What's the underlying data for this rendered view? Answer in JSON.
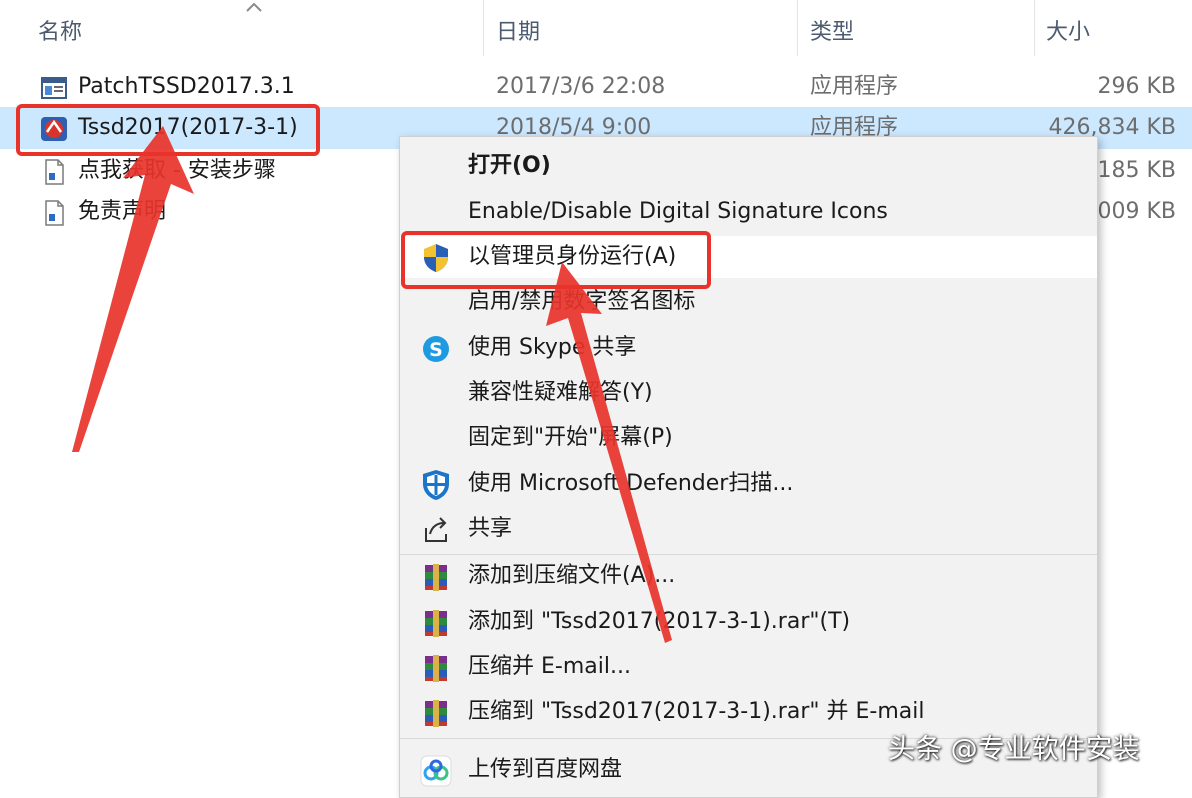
{
  "columns": {
    "name": "名称",
    "date": "日期",
    "type": "类型",
    "size": "大小"
  },
  "files": [
    {
      "name": "PatchTSSD2017.3.1",
      "date": "2017/3/6 22:08",
      "type": "应用程序",
      "size": "296 KB",
      "icon": "exe-window-icon"
    },
    {
      "name": "Tssd2017(2017-3-1)",
      "date": "2018/5/4 9:00",
      "type": "应用程序",
      "size": "426,834 KB",
      "icon": "tssd-app-icon"
    },
    {
      "name": "点我获取 - 安装步骤",
      "date": "",
      "type": "",
      "size": "185 KB",
      "icon": "document-icon"
    },
    {
      "name": "免责声明",
      "date": "",
      "type": "",
      "size": "009 KB",
      "icon": "document-icon"
    }
  ],
  "context_menu": {
    "items": [
      {
        "label": "打开(O)",
        "icon": "",
        "bold": true
      },
      {
        "label": "Enable/Disable Digital Signature Icons",
        "icon": ""
      },
      {
        "label": "以管理员身份运行(A)",
        "icon": "uac-shield-icon"
      },
      {
        "label": "启用/禁用数字签名图标",
        "icon": ""
      },
      {
        "label": "使用 Skype 共享",
        "icon": "skype-icon"
      },
      {
        "label": "兼容性疑难解答(Y)",
        "icon": ""
      },
      {
        "label": "固定到\"开始\"屏幕(P)",
        "icon": ""
      },
      {
        "label": "使用 Microsoft Defender扫描...",
        "icon": "defender-icon"
      },
      {
        "label": "共享",
        "icon": "share-icon"
      },
      {
        "label": "添加到压缩文件(A)...",
        "icon": "winrar-icon"
      },
      {
        "label": "添加到 \"Tssd2017(2017-3-1).rar\"(T)",
        "icon": "winrar-icon"
      },
      {
        "label": "压缩并 E-mail...",
        "icon": "winrar-icon"
      },
      {
        "label": "压缩到 \"Tssd2017(2017-3-1).rar\" 并 E-mail",
        "icon": "winrar-icon"
      },
      {
        "label": "上传到百度网盘",
        "icon": "baidu-netdisk-icon"
      }
    ]
  },
  "watermark": "头条 @专业软件安装",
  "colors": {
    "selection": "#cce8ff",
    "annotation_red": "#e8332a",
    "menu_bg": "#f2f2f2"
  }
}
